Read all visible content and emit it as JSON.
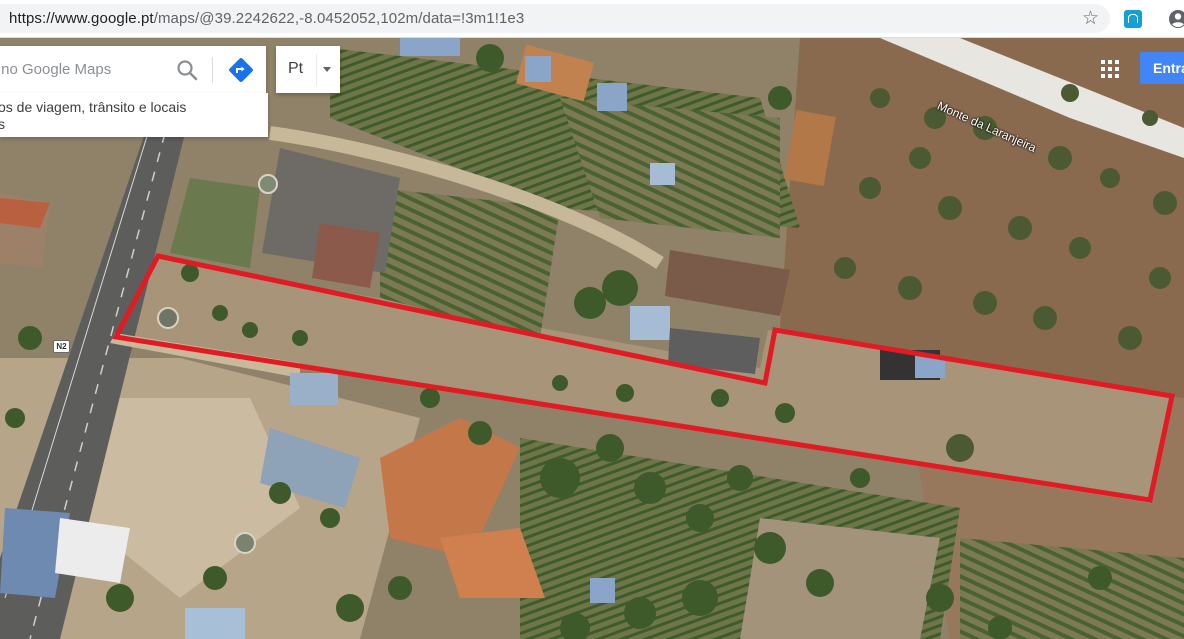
{
  "browser": {
    "url_host": "https://www.google.pt",
    "url_path": "/maps/@39.2242622,-8.0452052,102m/data=!3m1!1e3",
    "bookmark_icon": "star-icon",
    "extension_icon": "extension-icon",
    "profile_icon": "account-icon"
  },
  "maps": {
    "search_placeholder": "r no Google Maps",
    "search_icon": "search-icon",
    "directions_icon": "directions-icon",
    "hint_line1": "os de viagem, trânsito e locais",
    "hint_line2": "s",
    "language_label": "Pt",
    "apps_icon": "apps-grid-icon",
    "signin_label": "Entra"
  },
  "map": {
    "view": "satellite",
    "street_label": "Monte da Laranjeira",
    "route_shield": "N2",
    "plot_outline_color": "#e01b24"
  }
}
